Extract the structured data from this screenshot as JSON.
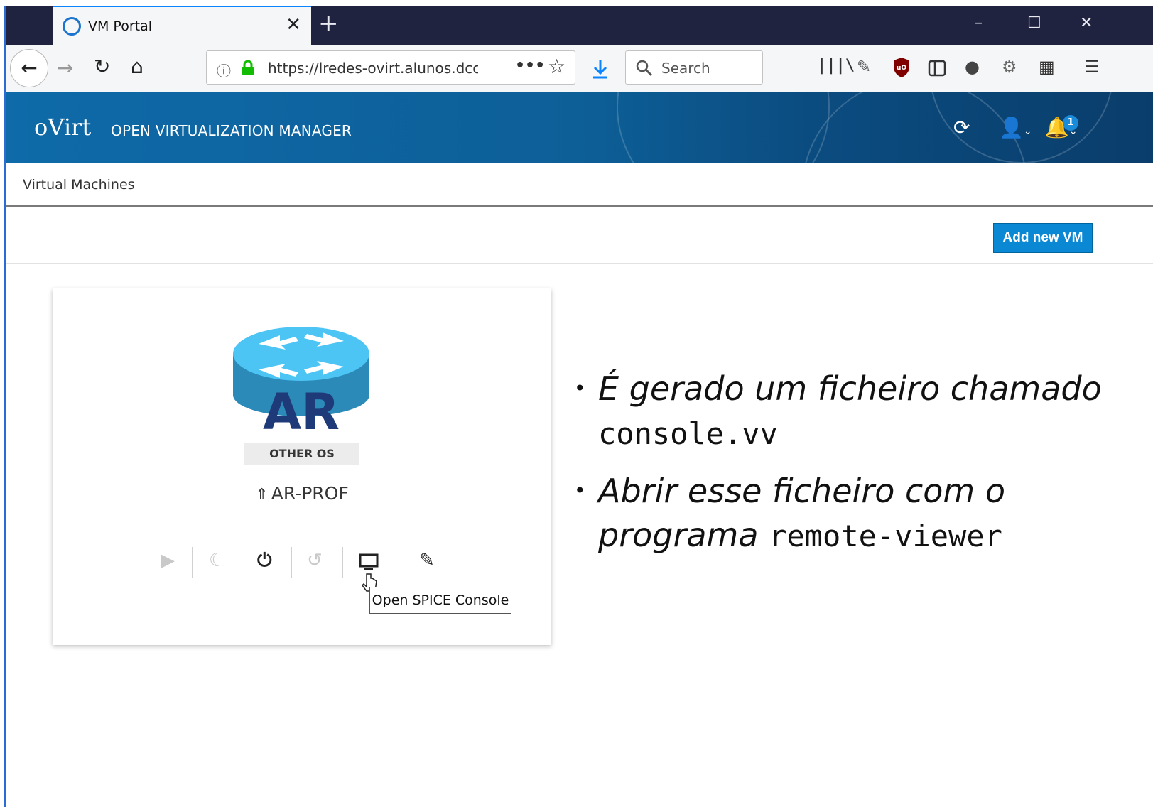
{
  "browser": {
    "tab_title": "VM Portal",
    "tab_close": "✕",
    "new_tab": "+",
    "url": "https://lredes-ovirt.alunos.dcc",
    "search_placeholder": "Search",
    "window_controls": [
      "–",
      "☐",
      "✕"
    ],
    "icons": [
      "back-icon",
      "forward-icon",
      "reload-icon",
      "home-icon",
      "info-icon",
      "lock-icon",
      "more-icon",
      "bookmark-star-icon",
      "download-icon",
      "search-icon",
      "library-icon",
      "eyedropper-icon",
      "ublock-icon",
      "sidebar-icon",
      "extension-icon",
      "settings-icon",
      "extension-grid-icon",
      "menu-icon"
    ]
  },
  "ovirt": {
    "logo": "oVirt",
    "title": "OPEN VIRTUALIZATION MANAGER",
    "notification_count": "1",
    "breadcrumb": "Virtual Machines",
    "add_vm_label": "Add new VM",
    "colors": {
      "header": "#0e6aa8",
      "button": "#0a88d4",
      "accent": "#0a84ff"
    }
  },
  "vm": {
    "logo_text": "AR",
    "os": "OTHER OS",
    "name": "AR-PROF",
    "tooltip": "Open SPICE Console"
  },
  "slide": {
    "bullet1_text": "É gerado um ficheiro chamado",
    "bullet1_code": "console.vv",
    "bullet2_text": "Abrir esse ficheiro com o programa",
    "bullet2_code": "remote-viewer"
  }
}
